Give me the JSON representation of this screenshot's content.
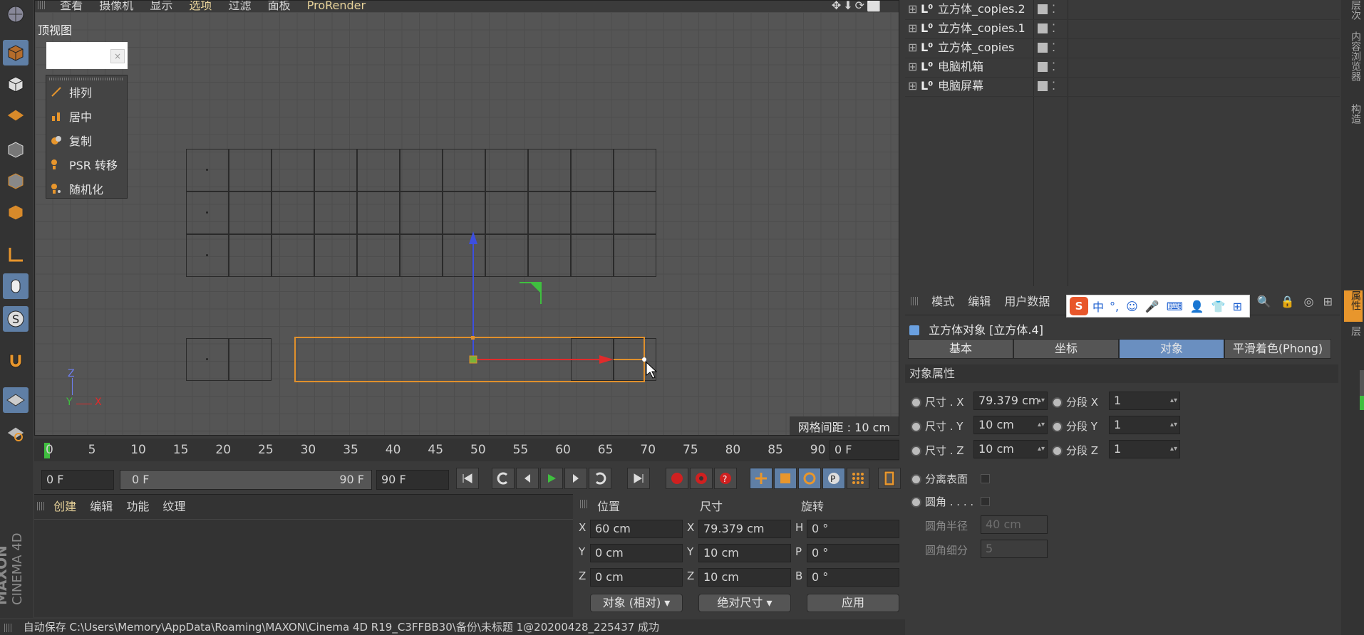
{
  "viewport": {
    "menu": [
      "查看",
      "摄像机",
      "显示",
      "选项",
      "过滤",
      "面板",
      "ProRender"
    ],
    "label": "顶视图",
    "grid_spacing": "网格间距 : 10 cm",
    "axis": {
      "z": "Z",
      "y": "Y",
      "x": "X"
    }
  },
  "popup": {
    "items": [
      "排列",
      "居中",
      "复制",
      "PSR 转移",
      "随机化"
    ]
  },
  "timeline": {
    "ticks": [
      "0",
      "5",
      "10",
      "15",
      "20",
      "25",
      "30",
      "35",
      "40",
      "45",
      "50",
      "55",
      "60",
      "65",
      "70",
      "75",
      "80",
      "85",
      "90"
    ],
    "current_frame": "0 F",
    "start": "0 F",
    "range_start": "0 F",
    "range_end": "90 F",
    "end": "90 F"
  },
  "material_panel": {
    "menu": [
      "创建",
      "编辑",
      "功能",
      "纹理"
    ],
    "brand_top": "MAXON",
    "brand_bottom": "CINEMA 4D"
  },
  "coords": {
    "headers": {
      "position": "位置",
      "size": "尺寸",
      "rotation": "旋转"
    },
    "rows": [
      {
        "axis": "X",
        "pos": "60 cm",
        "saxis": "X",
        "size": "79.379 cm",
        "raxis": "H",
        "rot": "0 °"
      },
      {
        "axis": "Y",
        "pos": "0 cm",
        "saxis": "Y",
        "size": "10 cm",
        "raxis": "P",
        "rot": "0 °"
      },
      {
        "axis": "Z",
        "pos": "0 cm",
        "saxis": "Z",
        "size": "10 cm",
        "raxis": "B",
        "rot": "0 °"
      }
    ],
    "mode": "对象 (相对)",
    "size_mode": "绝对尺寸",
    "apply": "应用"
  },
  "status": "自动保存 C:\\Users\\Memory\\AppData\\Roaming\\MAXON\\Cinema 4D R19_C3FFBB30\\备份\\未标题 1@20200428_225437 成功",
  "objects": [
    {
      "name": "立方体_copies.2"
    },
    {
      "name": "立方体_copies.1"
    },
    {
      "name": "立方体_copies"
    },
    {
      "name": "电脑机箱"
    },
    {
      "name": "电脑屏幕"
    }
  ],
  "attributes": {
    "menu": [
      "模式",
      "编辑",
      "用户数据"
    ],
    "title": "立方体对象 [立方体.4]",
    "tabs": [
      "基本",
      "坐标",
      "对象",
      "平滑着色(Phong)"
    ],
    "section": "对象属性",
    "size_x_label": "尺寸 . X",
    "size_x": "79.379 cm",
    "size_y_label": "尺寸 . Y",
    "size_y": "10 cm",
    "size_z_label": "尺寸 . Z",
    "size_z": "10 cm",
    "seg_x_label": "分段 X",
    "seg_x": "1",
    "seg_y_label": "分段 Y",
    "seg_y": "1",
    "seg_z_label": "分段 Z",
    "seg_z": "1",
    "separate_surfaces": "分离表面",
    "fillet": "圆角 . . . .",
    "fillet_radius_label": "圆角半径",
    "fillet_radius": "40 cm",
    "fillet_sub_label": "圆角细分",
    "fillet_sub": "5"
  },
  "right_tabs": [
    "层次",
    "内容浏览器",
    "构造",
    "属性",
    "层"
  ],
  "ime": {
    "logo": "S",
    "lang": "中"
  },
  "colors": {
    "accent": "#6a8fc0",
    "selection": "#e0902c",
    "yaxis": "#3d4fe0",
    "xaxis": "#e02b2b",
    "zaxis": "#3fbf3f"
  }
}
